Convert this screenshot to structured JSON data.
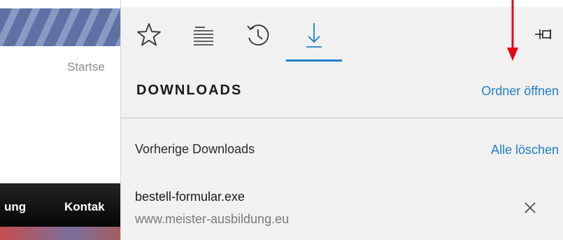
{
  "page": {
    "home_label": "Startse",
    "nav_items": [
      "ung",
      "Kontak"
    ]
  },
  "hub": {
    "tabs": [
      {
        "name": "favorites",
        "icon": "star-icon"
      },
      {
        "name": "reading-list",
        "icon": "reading-list-icon"
      },
      {
        "name": "history",
        "icon": "history-icon"
      },
      {
        "name": "downloads",
        "icon": "download-icon",
        "active": true
      }
    ],
    "pin_icon": "pin-icon",
    "title": "DOWNLOADS",
    "open_folder": "Ordner öffnen",
    "previous_label": "Vorherige Downloads",
    "clear_all": "Alle löschen",
    "downloads": [
      {
        "file": "bestell-formular.exe",
        "source": "www.meister-ausbildung.eu"
      }
    ]
  },
  "colors": {
    "accent": "#1f7fc7",
    "panel_bg": "#f1f1f1",
    "annotation_arrow": "#e30613"
  }
}
